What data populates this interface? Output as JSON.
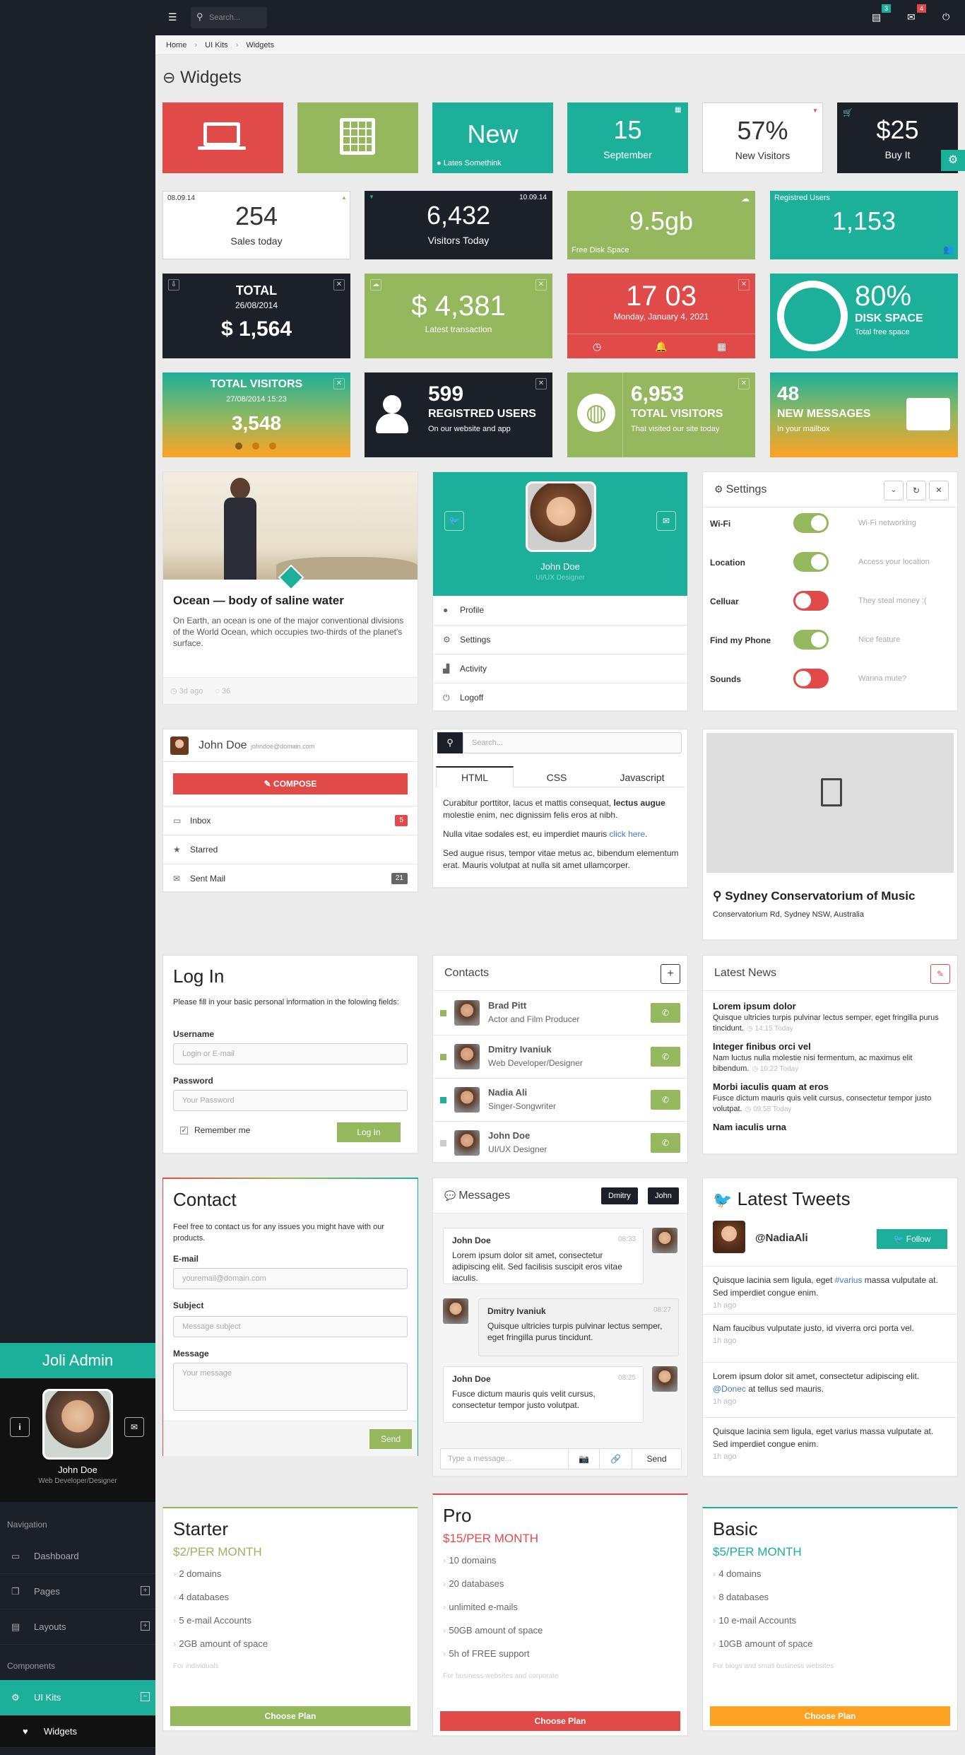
{
  "brand": "Joli Admin",
  "profile": {
    "name": "John Doe",
    "role": "Web Developer/Designer"
  },
  "nav": {
    "section1": "Navigation",
    "dashboard": "Dashboard",
    "pages": "Pages",
    "layouts": "Layouts",
    "section2": "Components",
    "uikits": "UI Kits",
    "widgets": "Widgets"
  },
  "top": {
    "search_placeholder": "Search...",
    "badge_tasks": "3",
    "badge_messages": "4"
  },
  "breadcrumb": {
    "home": "Home",
    "ui": "UI Kits",
    "current": "Widgets"
  },
  "page_title": "Widgets",
  "row1": {
    "new": "New",
    "new_sub": "Lates Somethink",
    "day": "15",
    "month": "September",
    "visitors_pct": "57%",
    "visitors_label": "New Visitors",
    "price": "$25",
    "buy": "Buy It"
  },
  "row2": {
    "date1": "08.09.14",
    "sales": "254",
    "sales_label": "Sales today",
    "date2": "10.09.14",
    "visitors": "6,432",
    "visitors_label": "Visitors Today",
    "disk": "9.5gb",
    "disk_label": "Free Disk Space",
    "reg_label": "Registred Users",
    "reg": "1,153"
  },
  "row3": {
    "total_label": "TOTAL",
    "total_date": "26/08/2014",
    "total": "$ 1,564",
    "trans": "$ 4,381",
    "trans_label": "Latest transaction",
    "time": "17 03",
    "date": "Monday, January 4, 2021",
    "disk_pct": "80%",
    "disk_title": "DISK SPACE",
    "disk_sub": "Total free space"
  },
  "row4": {
    "tv_title": "TOTAL VISITORS",
    "tv_date": "27/08/2014 15:23",
    "tv_value": "3,548",
    "ru_value": "599",
    "ru_title": "REGISTRED USERS",
    "ru_sub": "On our website and app",
    "tv2_value": "6,953",
    "tv2_title": "TOTAL VISITORS",
    "tv2_sub": "That visited our site today",
    "msg_value": "48",
    "msg_title": "NEW MESSAGES",
    "msg_sub": "In your mailbox"
  },
  "article": {
    "title": "Ocean — body of saline water",
    "text": "On Earth, an ocean is one of the major conventional divisions of the World Ocean, which occupies two-thirds of the planet's surface.",
    "time": "3d ago",
    "comments": "36"
  },
  "profile_card": {
    "name": "John Doe",
    "role": "UI/UX Designer",
    "items": [
      "Profile",
      "Settings",
      "Activity",
      "Logoff"
    ]
  },
  "settings": {
    "title": "Settings",
    "rows": [
      {
        "label": "Wi-Fi",
        "desc": "Wi-Fi networking",
        "on": true
      },
      {
        "label": "Location",
        "desc": "Access your location",
        "on": true
      },
      {
        "label": "Celluar",
        "desc": "They steal money :(",
        "on": false
      },
      {
        "label": "Find my Phone",
        "desc": "Nice feature",
        "on": true
      },
      {
        "label": "Sounds",
        "desc": "Wanna mute?",
        "on": false
      }
    ]
  },
  "mail": {
    "name": "John Doe",
    "email": "johndoe@domain.com",
    "compose": "COMPOSE",
    "inbox": "Inbox",
    "inbox_count": "5",
    "starred": "Starred",
    "sent": "Sent Mail",
    "sent_count": "21"
  },
  "tabs": {
    "search_placeholder": "Search...",
    "tab1": "HTML",
    "tab2": "CSS",
    "tab3": "Javascript",
    "p1a": "Curabitur porttitor, lacus et mattis consequat, ",
    "p1b": "lectus augue",
    "p1c": " molestie enim, nec dignissim felis eros at nibh.",
    "p2a": "Nulla vitae sodales est, eu imperdiet mauris ",
    "p2link": "click here",
    "p2b": ".",
    "p3": "Sed augue risus, tempor vitae metus ac, bibendum elementum erat. Mauris volutpat at nulla sit amet ullamcorper."
  },
  "location": {
    "title": "Sydney Conservatorium of Music",
    "address": "Conservatorium Rd, Sydney NSW, Australia"
  },
  "login": {
    "title": "Log In",
    "desc": "Please fill in your basic personal information in the folowing fields:",
    "username": "Username",
    "username_ph": "Login or E-mail",
    "password": "Password",
    "password_ph": "Your Password",
    "remember": "Remember me",
    "button": "Log In"
  },
  "contacts": {
    "title": "Contacts",
    "items": [
      {
        "name": "Brad Pitt",
        "role": "Actor and Film Producer",
        "status": "#95b75d"
      },
      {
        "name": "Dmitry Ivaniuk",
        "role": "Web Developer/Designer",
        "status": "#95b75d"
      },
      {
        "name": "Nadia Ali",
        "role": "Singer-Songwriter",
        "status": "#1caf9a"
      },
      {
        "name": "John Doe",
        "role": "UI/UX Designer",
        "status": "#ccc"
      }
    ]
  },
  "news": {
    "title": "Latest News",
    "items": [
      {
        "title": "Lorem ipsum dolor",
        "text": "Quisque ultricies turpis pulvinar lectus semper, eget fringilla purus tincidunt.",
        "time": "14:15 Today"
      },
      {
        "title": "Integer finibus orci vel",
        "text": "Nam luctus nulla molestie nisi fermentum, ac maximus elit bibendum.",
        "time": "10:22 Today"
      },
      {
        "title": "Morbi iaculis quam at eros",
        "text": "Fusce dictum mauris quis velit cursus, consectetur tempor justo volutpat.",
        "time": "09:58 Today"
      },
      {
        "title": "Nam iaculis urna",
        "text": "",
        "time": ""
      }
    ]
  },
  "contact": {
    "title": "Contact",
    "desc": "Feel free to contact us for any issues you might have with our products.",
    "email": "E-mail",
    "email_ph": "youremail@domain.com",
    "subject": "Subject",
    "subject_ph": "Message subject",
    "message": "Message",
    "message_ph": "Your message",
    "send": "Send"
  },
  "messages": {
    "title": "Messages",
    "tag1": "Dmitry",
    "tag2": "John",
    "items": [
      {
        "name": "John Doe",
        "time": "08:33",
        "text": "Lorem ipsum dolor sit amet, consectetur adipiscing elit. Sed facilisis suscipit eros vitae iaculis."
      },
      {
        "name": "Dmitry Ivaniuk",
        "time": "08:27",
        "text": "Quisque ultricies turpis pulvinar lectus semper, eget fringilla purus tincidunt."
      },
      {
        "name": "John Doe",
        "time": "08:25",
        "text": "Fusce dictum mauris quis velit cursus, consectetur tempor justo volutpat."
      }
    ],
    "input_ph": "Type a message...",
    "send": "Send"
  },
  "tweets": {
    "title": "Latest Tweets",
    "user": "@NadiaAli",
    "follow": "Follow",
    "items": [
      {
        "a": "Quisque lacinia sem ligula, eget ",
        "link": "#varius",
        "b": " massa vulputate at. Sed imperdiet congue enim.",
        "time": "1h ago"
      },
      {
        "a": "Nam faucibus vulputate justo, id viverra orci porta vel.",
        "link": "",
        "b": "",
        "time": "1h ago"
      },
      {
        "a": "Lorem ipsum dolor sit amet, consectetur adipiscing elit. ",
        "link": "@Donec",
        "b": " at tellus sed mauris.",
        "time": "1h ago"
      },
      {
        "a": "Quisque lacinia sem ligula, eget varius massa vulputate at. Sed imperdiet congue enim.",
        "link": "",
        "b": "",
        "time": "1h ago"
      }
    ]
  },
  "pricing": [
    {
      "name": "Starter",
      "price": "$2/PER MONTH",
      "color": "#95b75d",
      "items": [
        "2 domains",
        "4 databases",
        "5 e-mail Accounts",
        "2GB amount of space"
      ],
      "note": "For individuals",
      "button": "Choose Plan"
    },
    {
      "name": "Pro",
      "price": "$15/PER MONTH",
      "color": "#e04b4a",
      "items": [
        "10 domains",
        "20 databases",
        "unlimited e-mails",
        "50GB amount of space",
        "5h of FREE support"
      ],
      "note": "For business websites and corporate",
      "button": "Choose Plan"
    },
    {
      "name": "Basic",
      "price": "$5/PER MONTH",
      "color": "#1caf9a",
      "items": [
        "4 domains",
        "8 databases",
        "10 e-mail Accounts",
        "10GB amount of space"
      ],
      "note": "For blogs and small business websites",
      "button": "Choose Plan"
    }
  ]
}
